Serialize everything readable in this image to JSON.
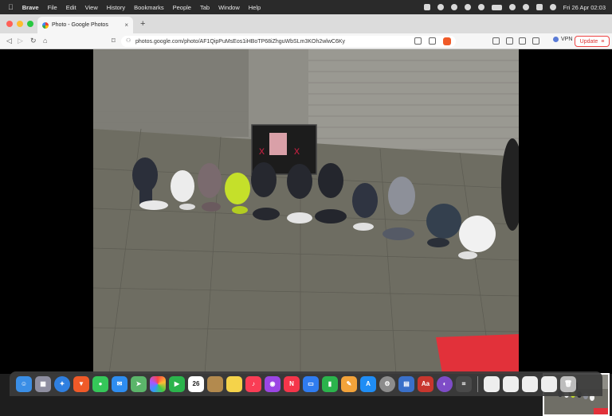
{
  "menubar": {
    "apple": "",
    "app_name": "Brave",
    "items": [
      "File",
      "Edit",
      "View",
      "History",
      "Bookmarks",
      "People",
      "Tab",
      "Window",
      "Help"
    ],
    "datetime": "Fri 26 Apr  02:03"
  },
  "tab": {
    "title": "Photo - Google Photos",
    "close": "×",
    "new_tab": "+"
  },
  "toolbar": {
    "back": "◁",
    "forward": "▷",
    "reload": "↻",
    "home": "⌂",
    "bookmark": "⌑",
    "url": "photos.google.com/photo/AF1QipPuMsEos1iHBoTP68iZhguWbSLm3KOh2wlwC6Ky",
    "vpn_label": "VPN",
    "update_label": "Update",
    "menu": "≡"
  },
  "dock": {
    "calendar_day": "26",
    "dictionary_label": "Aa",
    "items": [
      "finder",
      "launchpad",
      "safari",
      "brave",
      "messages",
      "mail",
      "maps",
      "photos",
      "facetime",
      "calendar",
      "notes-brown",
      "notes",
      "music",
      "podcasts",
      "news",
      "keynote",
      "numbers",
      "pages",
      "app-store",
      "system-settings",
      "preview",
      "dictionary",
      "tor",
      "screenshot"
    ]
  },
  "colors": {
    "menubar": "#2a2a2a",
    "tabbar": "#dcdcdc",
    "toolbar": "#f6f6f6",
    "update_accent": "#dd3333"
  }
}
